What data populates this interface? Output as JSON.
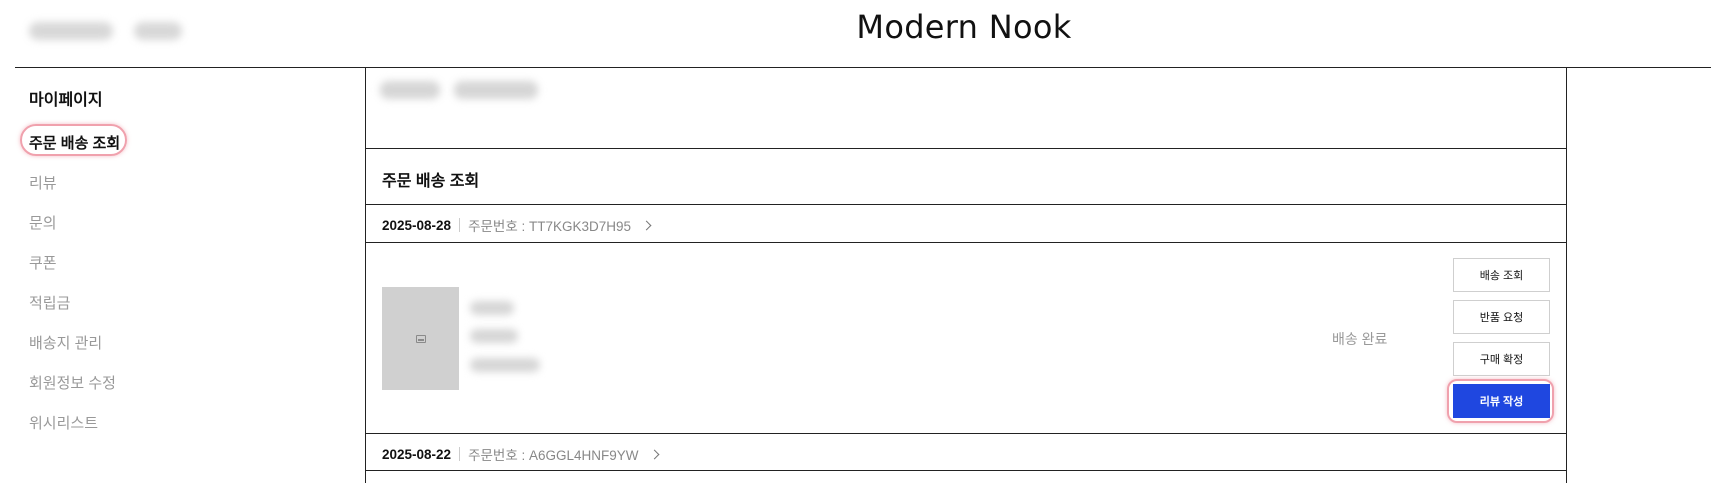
{
  "header": {
    "brand": "Modern Nook"
  },
  "sidebar": {
    "title": "마이페이지",
    "items": [
      {
        "label": "주문 배송 조회",
        "active": true
      },
      {
        "label": "리뷰"
      },
      {
        "label": "문의"
      },
      {
        "label": "쿠폰"
      },
      {
        "label": "적립금"
      },
      {
        "label": "배송지 관리"
      },
      {
        "label": "회원정보 수정"
      },
      {
        "label": "위시리스트"
      }
    ]
  },
  "main": {
    "section_title": "주문 배송 조회",
    "orders": [
      {
        "date": "2025-08-28",
        "order_no": "주문번호 : TT7KGK3D7H95",
        "status": "배송 완료",
        "actions": [
          "배송 조회",
          "반품 요청",
          "구매 확정",
          "리뷰 작성"
        ]
      },
      {
        "date": "2025-08-22",
        "order_no": "주문번호 : A6GGL4HNF9YW"
      }
    ]
  },
  "colors": {
    "accent": "#1f47e0",
    "focus_ring": "#f0a1ad",
    "muted_text": "#999999"
  }
}
